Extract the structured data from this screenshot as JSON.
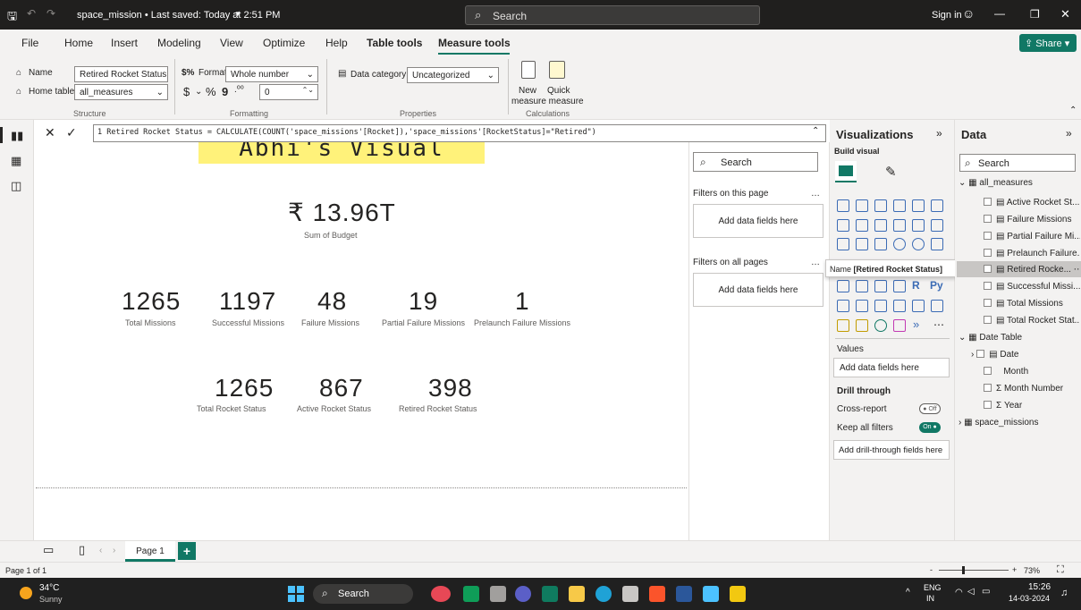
{
  "title_bar": {
    "file_title": "space_mission • Last saved: Today at 2:51 PM",
    "search": "Search",
    "signin": "Sign in"
  },
  "menu": {
    "items": [
      "File",
      "Home",
      "Insert",
      "Modeling",
      "View",
      "Optimize",
      "Help",
      "Table tools",
      "Measure tools"
    ],
    "share": "Share"
  },
  "ribbon": {
    "name_label": "Name",
    "name_value": "Retired Rocket Status",
    "home_table_label": "Home table",
    "home_table_value": "all_measures",
    "format_label": "Format",
    "format_value": "Whole number",
    "currency": "$",
    "percent": "%",
    "comma": "9",
    "decimals": "0",
    "data_category_label": "Data category",
    "data_category_value": "Uncategorized",
    "new_measure": "New measure",
    "quick_measure": "Quick measure",
    "groups": {
      "structure": "Structure",
      "formatting": "Formatting",
      "properties": "Properties",
      "calculations": "Calculations"
    }
  },
  "formula": "1  Retired Rocket Status = CALCULATE(COUNT('space_missions'[Rocket]),'space_missions'[RocketStatus]=\"Retired\")",
  "canvas": {
    "title": "Abhi's Visual",
    "budget": {
      "value": "₹ 13.96T",
      "label": "Sum of Budget"
    },
    "missions": [
      {
        "value": "1265",
        "label": "Total Missions"
      },
      {
        "value": "1197",
        "label": "Successful Missions"
      },
      {
        "value": "48",
        "label": "Failure Missions"
      },
      {
        "value": "19",
        "label": "Partial Failure Missions"
      },
      {
        "value": "1",
        "label": "Prelaunch Failure Missions"
      }
    ],
    "rockets": [
      {
        "value": "1265",
        "label": "Total Rocket Status"
      },
      {
        "value": "867",
        "label": "Active Rocket Status"
      },
      {
        "value": "398",
        "label": "Retired Rocket Status"
      }
    ]
  },
  "filters": {
    "search": "Search",
    "on_page": "Filters on this page",
    "add_page": "Add data fields here",
    "on_all": "Filters on all pages",
    "add_all": "Add data fields here"
  },
  "viz": {
    "title": "Visualizations",
    "build": "Build visual",
    "tooltip_label": "Name",
    "tooltip_value": "[Retired Rocket Status]",
    "values": "Values",
    "values_add": "Add data fields here",
    "drill": "Drill through",
    "cross": "Cross-report",
    "cross_state": "Off",
    "keep": "Keep all filters",
    "keep_state": "On",
    "drill_add": "Add drill-through fields here"
  },
  "data": {
    "title": "Data",
    "search": "Search",
    "table1": "all_measures",
    "measures": [
      "Active Rocket St...",
      "Failure Missions",
      "Partial Failure Mi...",
      "Prelaunch Failure...",
      "Retired Rocke...",
      "Successful Missi...",
      "Total Missions",
      "Total Rocket Stat..."
    ],
    "table2": "Date Table",
    "date_items": [
      "Date",
      "Month",
      "Month Number",
      "Year"
    ],
    "table3": "space_missions"
  },
  "pages": {
    "tab": "Page 1",
    "status": "Page 1 of 1",
    "zoom": "73%"
  },
  "taskbar": {
    "temp": "34°C",
    "weather": "Sunny",
    "search": "Search",
    "lang": "ENG",
    "lang2": "IN",
    "time": "15:26",
    "date": "14-03-2024"
  },
  "colors": {
    "accent": "#117865",
    "highlight": "#fff27a",
    "dark": "#201f1e"
  }
}
